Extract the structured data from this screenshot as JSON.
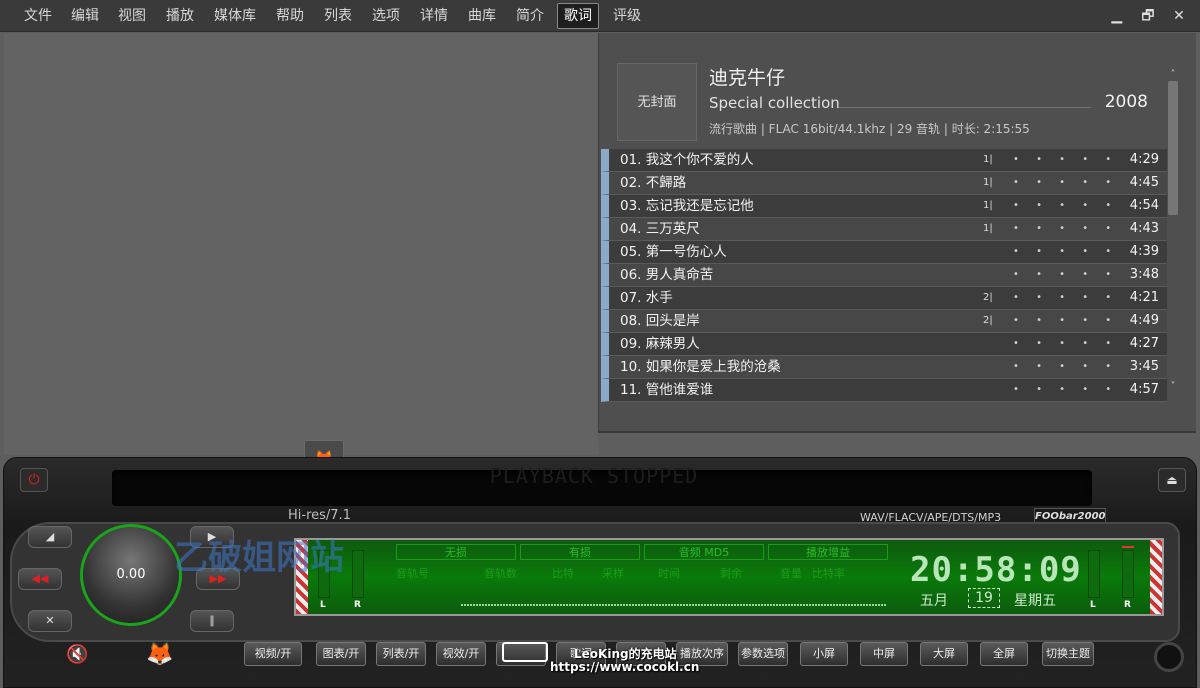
{
  "menu": [
    "文件",
    "编辑",
    "视图",
    "播放",
    "媒体库",
    "帮助",
    "列表",
    "选项",
    "详情",
    "曲库",
    "简介",
    "歌词",
    "评级"
  ],
  "menu_active": "歌词",
  "window_controls": {
    "minimize": "▁",
    "restore": "🗗",
    "close": "✕"
  },
  "album": {
    "cover_text": "无封面",
    "artist": "迪克牛仔",
    "title": "Special collection",
    "year": "2008",
    "meta": "流行歌曲 | FLAC 16bit/44.1khz | 29 音轨 | 时长: 2:15:55"
  },
  "tracks": [
    {
      "name": "01. 我这个你不爱的人",
      "rate": "1|",
      "dots": "• • • • •",
      "dur": "4:29"
    },
    {
      "name": "02. 不歸路",
      "rate": "1|",
      "dots": "• • • • •",
      "dur": "4:45"
    },
    {
      "name": "03. 忘记我还是忘记他",
      "rate": "1|",
      "dots": "• • • • •",
      "dur": "4:54"
    },
    {
      "name": "04. 三万英尺",
      "rate": "1|",
      "dots": "• • • • •",
      "dur": "4:43"
    },
    {
      "name": "05. 第一号伤心人",
      "rate": "",
      "dots": "• • • • •",
      "dur": "4:39"
    },
    {
      "name": "06. 男人真命苦",
      "rate": "",
      "dots": "• • • • •",
      "dur": "3:48"
    },
    {
      "name": "07. 水手",
      "rate": "2|",
      "dots": "• • • • •",
      "dur": "4:21"
    },
    {
      "name": "08. 回头是岸",
      "rate": "2|",
      "dots": "• • • • •",
      "dur": "4:49"
    },
    {
      "name": "09. 麻辣男人",
      "rate": "",
      "dots": "• • • • •",
      "dur": "4:27"
    },
    {
      "name": "10. 如果你是爱上我的沧桑",
      "rate": "",
      "dots": "• • • • •",
      "dur": "3:45"
    },
    {
      "name": "11. 管他谁爱谁",
      "rate": "",
      "dots": "• • • • •",
      "dur": "4:57"
    }
  ],
  "scroll": {
    "up": "˄",
    "down": "˅"
  },
  "stereo": {
    "status": "PLAYBACK STOPPED",
    "hires": "Hi-res/7.1",
    "formats": "WAV/FLACV/APE/DTS/MP3",
    "brand": "FOObar2000",
    "knob_value": "0.00",
    "tags": [
      "无损",
      "有损",
      "音频 MD5",
      "播放增益"
    ],
    "labels": [
      "音轨号",
      "音轨数",
      "比特",
      "采样",
      "时间",
      "剩余",
      "音量",
      "比特率"
    ],
    "clock": "20:58:09",
    "month": "五月",
    "day": "19",
    "weekday": "星期五",
    "watermark": "乙破姐网站",
    "vu_labels": {
      "left": "L",
      "right": "R"
    },
    "side_buttons": [
      "◢",
      "◀◀",
      "✕",
      "▶",
      "▶▶",
      "∥"
    ],
    "icons": {
      "power": "⏻",
      "eject": "⏏",
      "mute": "🔇",
      "logo": "🦊"
    },
    "buttons": [
      "视频/开",
      "图表/开",
      "列表/开",
      "视效/开",
      "",
      "歌词",
      "",
      "播放次序",
      "参数选项",
      "小屏",
      "中屏",
      "大屏",
      "全屏",
      "切换主题"
    ],
    "credit_line1": "LeoKing的充电站",
    "credit_line2": "https://www.cocokl.cn"
  },
  "colors": {
    "accent_green": "#1aa41a",
    "track_marker": "#8ba9c9",
    "power_red": "#e02020"
  }
}
